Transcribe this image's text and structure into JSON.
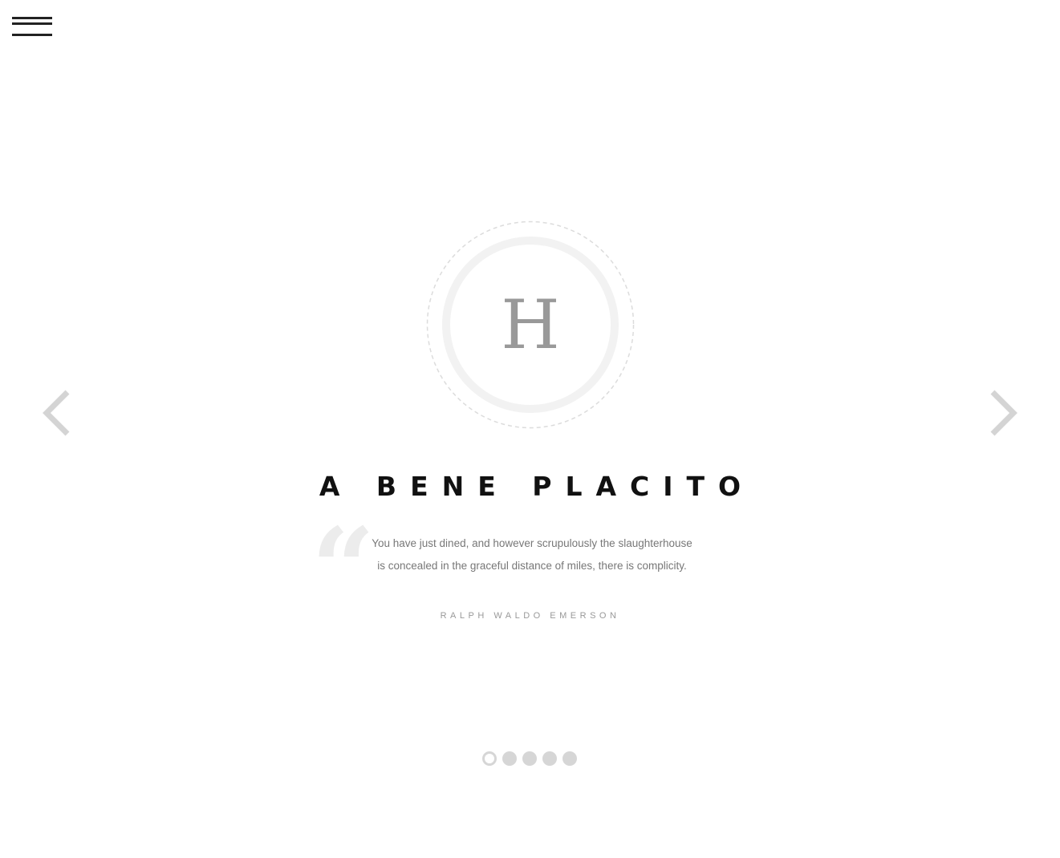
{
  "nav": {
    "menu_icon": "hamburger-icon",
    "prev_icon": "chevron-left-icon",
    "next_icon": "chevron-right-icon"
  },
  "logo": {
    "letter": "H"
  },
  "title": "A BENE PLACITO",
  "testimonial": {
    "quote_icon": "quote-open-icon",
    "text": "You have just dined, and however scrupulously the slaughterhouse is concealed in the graceful distance of miles, there is complicity.",
    "author": "RALPH WALDO EMERSON"
  },
  "pagination": {
    "total": 5,
    "active_index": 0
  },
  "colors": {
    "background": "#ffffff",
    "title": "#111111",
    "muted": "#777777",
    "light": "#d6d6d6"
  }
}
